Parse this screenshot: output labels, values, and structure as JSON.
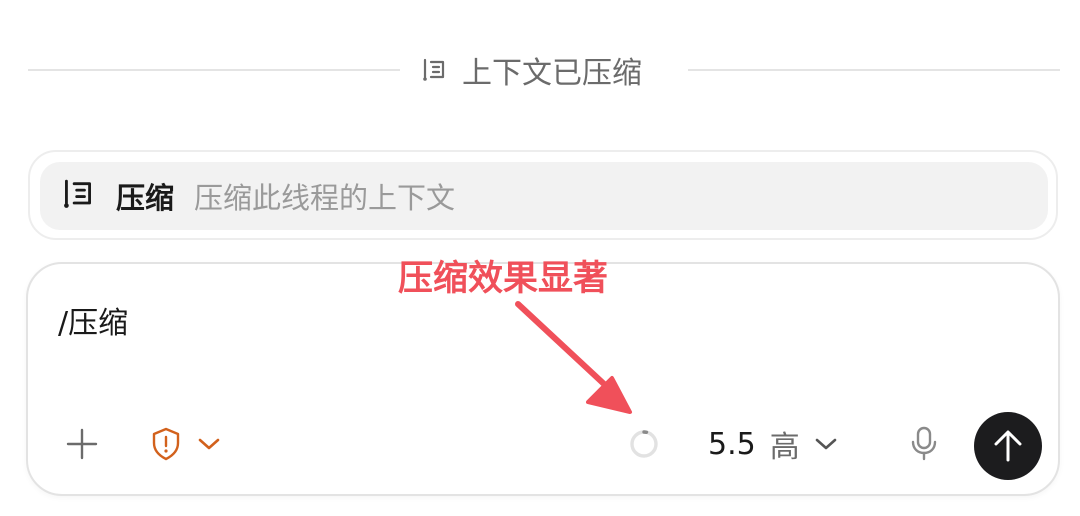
{
  "divider": {
    "label": "上下文已压缩",
    "icon": "compress-context-icon",
    "line_color": "#e4e4e4",
    "text_color": "#6b6b6b"
  },
  "suggestion": {
    "icon": "compress-context-icon",
    "name": "压缩",
    "description": "压缩此线程的上下文",
    "bg_color": "#f2f2f2"
  },
  "composer": {
    "input_value": "/压缩",
    "add_icon": "plus-icon",
    "permission_icon": "shield-alert-icon",
    "permission_chevron_icon": "chevron-down-icon",
    "permission_color": "#d2611c",
    "progress_icon": "context-usage-ring-icon",
    "model_version": "5.5",
    "model_effort": "高",
    "model_chevron_icon": "chevron-down-icon",
    "mic_icon": "microphone-icon",
    "send_icon": "arrow-up-icon",
    "send_bg_color": "#1c1c1e"
  },
  "annotation": {
    "text": "压缩效果显著",
    "color": "#f0505a"
  }
}
